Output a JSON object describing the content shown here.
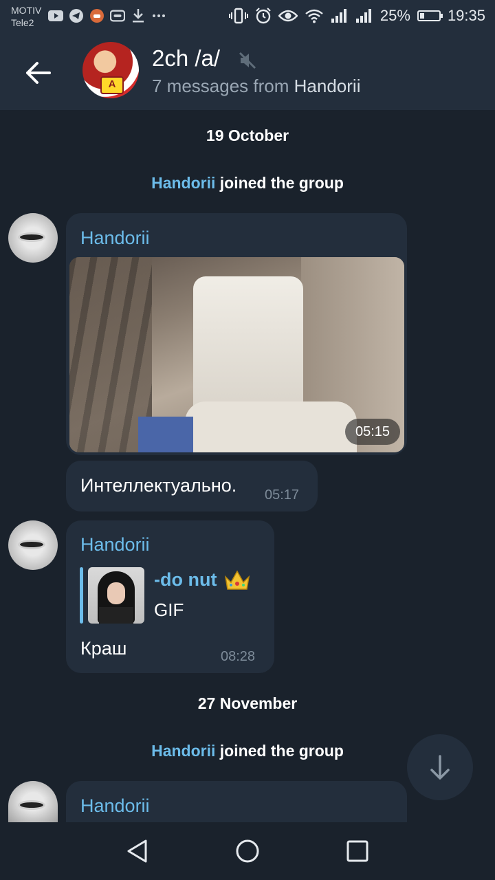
{
  "status_bar": {
    "carrier_1": "MOTIV",
    "carrier_2": "Tele2",
    "battery": "25%",
    "time": "19:35",
    "icons": [
      "youtube-icon",
      "telegram-icon",
      "app-icon",
      "vr-icon",
      "download-icon",
      "more-icon",
      "vibrate-icon",
      "alarm-icon",
      "eye-icon",
      "wifi-icon",
      "signal-icon",
      "signal-icon",
      "battery-icon"
    ],
    "battery_level": 0.25
  },
  "header": {
    "title": "2ch /a/",
    "subtitle_prefix": "7 messages from",
    "subtitle_user": "Handorii",
    "avatar_badge": "A",
    "muted": true
  },
  "messages": [
    {
      "type": "date",
      "text": "19 October"
    },
    {
      "type": "service",
      "user": "Handorii",
      "text": "joined the group"
    },
    {
      "type": "media",
      "sender": "Handorii",
      "media": "video",
      "time": "05:15"
    },
    {
      "type": "text",
      "text": "Интеллектуально.",
      "time": "05:17"
    },
    {
      "type": "reply",
      "sender": "Handorii",
      "reply_name": "-do nut",
      "reply_emoji": "crown",
      "reply_type": "GIF",
      "text": "Краш",
      "time": "08:28"
    },
    {
      "type": "date",
      "text": "27 November"
    },
    {
      "type": "service",
      "user": "Handorii",
      "text": "joined the group"
    },
    {
      "type": "partial",
      "sender": "Handorii"
    }
  ],
  "colors": {
    "background": "#1a222c",
    "bar": "#232e3c",
    "accent": "#6cbcea",
    "muted_text": "#7d8b99"
  }
}
